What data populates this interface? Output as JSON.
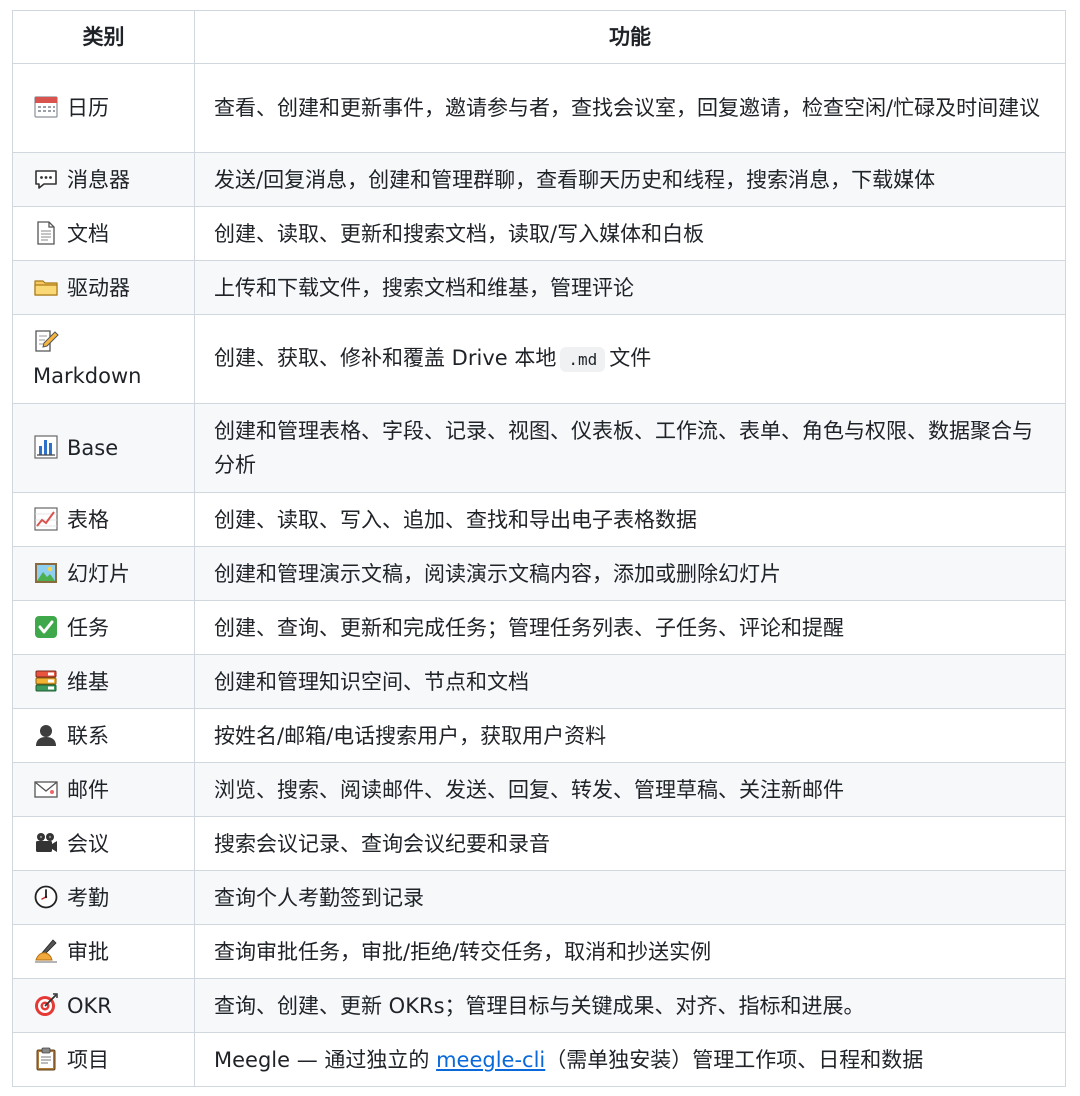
{
  "header": {
    "category": "类别",
    "function": "功能"
  },
  "rows": [
    {
      "icon": "calendar-icon",
      "category": "日历",
      "desc": "查看、创建和更新事件，邀请参与者，查找会议室，回复邀请，检查空闲/忙碌及时间建议"
    },
    {
      "icon": "speech-bubble-icon",
      "category": "消息器",
      "desc": "发送/回复消息，创建和管理群聊，查看聊天历史和线程，搜索消息，下载媒体"
    },
    {
      "icon": "document-icon",
      "category": "文档",
      "desc": "创建、读取、更新和搜索文档，读取/写入媒体和白板"
    },
    {
      "icon": "folder-icon",
      "category": "驱动器",
      "desc": "上传和下载文件，搜索文档和维基，管理评论"
    },
    {
      "icon": "memo-icon",
      "category": "Markdown",
      "desc_before": "创建、获取、修补和覆盖 Drive 本地",
      "code": ".md",
      "desc_after": "文件"
    },
    {
      "icon": "bar-chart-icon",
      "category": "Base",
      "desc": "创建和管理表格、字段、记录、视图、仪表板、工作流、表单、角色与权限、数据聚合与分析"
    },
    {
      "icon": "line-chart-icon",
      "category": "表格",
      "desc": "创建、读取、写入、追加、查找和导出电子表格数据"
    },
    {
      "icon": "picture-icon",
      "category": "幻灯片",
      "desc": "创建和管理演示文稿，阅读演示文稿内容，添加或删除幻灯片"
    },
    {
      "icon": "check-mark-icon",
      "category": "任务",
      "desc": "创建、查询、更新和完成任务；管理任务列表、子任务、评论和提醒"
    },
    {
      "icon": "books-icon",
      "category": "维基",
      "desc": "创建和管理知识空间、节点和文档"
    },
    {
      "icon": "user-silhouette-icon",
      "category": "联系",
      "desc": "按姓名/邮箱/电话搜索用户，获取用户资料"
    },
    {
      "icon": "envelope-icon",
      "category": "邮件",
      "desc": "浏览、搜索、阅读邮件、发送、回复、转发、管理草稿、关注新邮件"
    },
    {
      "icon": "movie-camera-icon",
      "category": "会议",
      "desc": "搜索会议记录、查询会议纪要和录音"
    },
    {
      "icon": "clock-icon",
      "category": "考勤",
      "desc": "查询个人考勤签到记录"
    },
    {
      "icon": "writing-hand-icon",
      "category": "审批",
      "desc": "查询审批任务，审批/拒绝/转交任务，取消和抄送实例"
    },
    {
      "icon": "target-icon",
      "category": "OKR",
      "desc": "查询、创建、更新 OKRs；管理目标与关键成果、对齐、指标和进展。"
    },
    {
      "icon": "clipboard-icon",
      "category": "项目",
      "desc_before": "Meegle — 通过独立的 ",
      "link": "meegle-cli",
      "desc_after": "（需单独安装）管理工作项、日程和数据"
    }
  ]
}
